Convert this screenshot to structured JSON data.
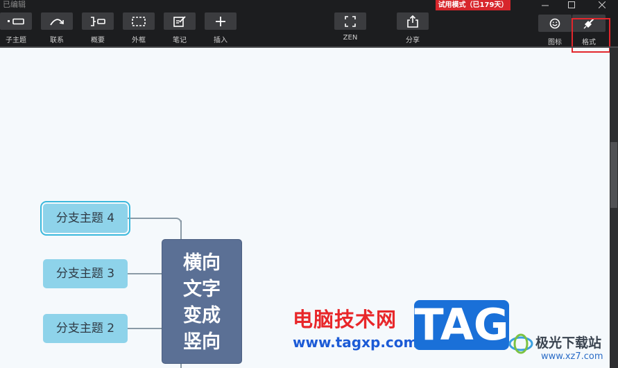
{
  "window": {
    "title": "已编辑",
    "trial_badge": "试用模式（已179天）"
  },
  "toolbar": {
    "subtopic_label": "子主题",
    "relation_label": "联系",
    "summary_label": "概要",
    "boundary_label": "外框",
    "note_label": "笔记",
    "insert_label": "插入",
    "zen_label": "ZEN",
    "share_label": "分享",
    "icon_label": "图标",
    "format_label": "格式"
  },
  "mindmap": {
    "central_topic": "横向\n文字\n变成\n竖向",
    "branches": [
      "分支主题 4",
      "分支主题 3",
      "分支主题 2"
    ]
  },
  "watermark": {
    "site_name": "电脑技术网",
    "site_url": "www.tagxp.com",
    "tag": "TAG",
    "xz_name": "极光下载站",
    "xz_url": "www.xz7.com"
  },
  "colors": {
    "toolbar_bg": "#1c1d1f",
    "canvas_bg": "#f5f9fc",
    "central_topic": "#5b7095",
    "branch": "#8ed3ea",
    "trial_badge": "#d7262b",
    "highlight": "#e3262c"
  }
}
